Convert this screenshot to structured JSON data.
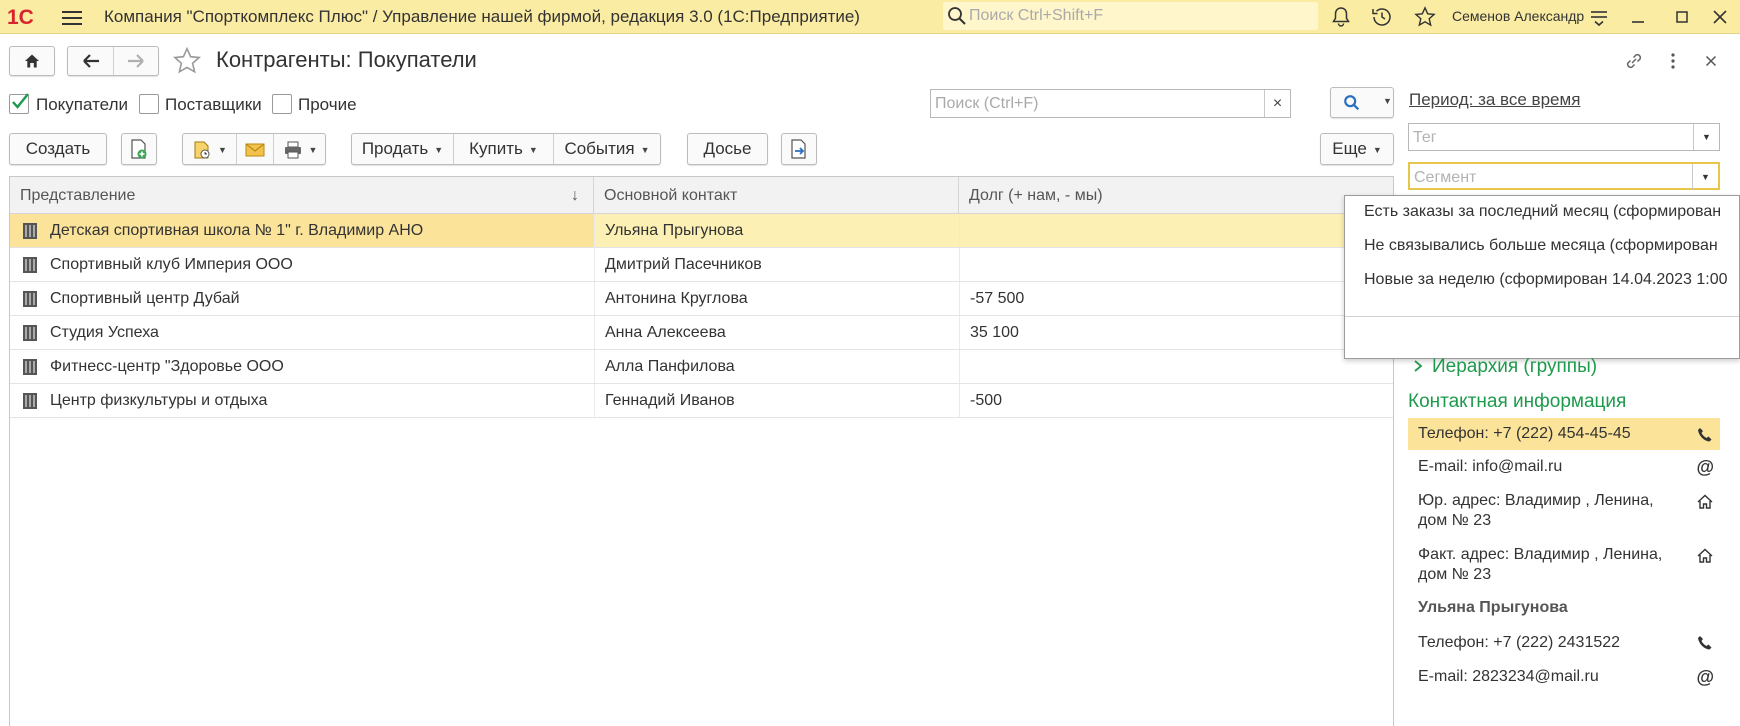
{
  "app": {
    "logo_text": "1С",
    "title": "Компания \"Спорткомплекс Плюс\" / Управление нашей фирмой, редакция 3.0  (1С:Предприятие)",
    "search_placeholder": "Поиск Ctrl+Shift+F",
    "user": "Семенов Александр"
  },
  "page": {
    "title": "Контрагенты: Покупатели"
  },
  "filters": [
    {
      "label": "Покупатели",
      "checked": true
    },
    {
      "label": "Поставщики",
      "checked": false
    },
    {
      "label": "Прочие",
      "checked": false
    }
  ],
  "list_search": {
    "placeholder": "Поиск (Ctrl+F)",
    "clear": "×"
  },
  "toolbar": {
    "create": "Создать",
    "sell": "Продать",
    "buy": "Купить",
    "events": "События",
    "dossier": "Досье",
    "more": "Еще"
  },
  "table": {
    "columns": [
      "Представление",
      "Основной контакт",
      "Долг (+ нам, - мы)"
    ],
    "sort_indicator": "↓",
    "rows": [
      {
        "name": "Детская спортивная школа  № 1\" г. Владимир АНО",
        "contact": "Ульяна Прыгунова",
        "debt": "",
        "selected": true
      },
      {
        "name": "Спортивный клуб Империя ООО",
        "contact": "Дмитрий Пасечников",
        "debt": ""
      },
      {
        "name": "Спортивный центр Дубай",
        "contact": "Антонина Круглова",
        "debt": "-57 500"
      },
      {
        "name": "Студия Успеха",
        "contact": "Анна Алексеева",
        "debt": "35 100"
      },
      {
        "name": "Фитнесс-центр \"Здоровье ООО",
        "contact": "Алла Панфилова",
        "debt": ""
      },
      {
        "name": "Центр физкультуры и отдыха",
        "contact": "Геннадий Иванов",
        "debt": "-500"
      }
    ]
  },
  "side": {
    "period": "Период: за все время",
    "tag_placeholder": "Тег",
    "segment_placeholder": "Сегмент",
    "segment_options": [
      "Есть заказы за последний месяц (сформирован",
      "Не связывались больше месяца (сформирован",
      "Новые за неделю (сформирован 14.04.2023 1:00"
    ],
    "hierarchy": "Иерархия (группы)",
    "contact_info_title": "Контактная информация",
    "company_contacts": [
      {
        "text": "Телефон: +7 (222) 454-45-45",
        "icon": "phone-icon",
        "selected": true
      },
      {
        "text": "E-mail: info@mail.ru",
        "icon": "email-icon"
      },
      {
        "text": "Юр. адрес: Владимир , Ленина, дом № 23",
        "icon": "home-icon"
      },
      {
        "text": "Факт. адрес: Владимир , Ленина, дом № 23",
        "icon": "home-icon"
      }
    ],
    "person": "Ульяна Прыгунова",
    "person_contacts": [
      {
        "text": "Телефон: +7 (222) 2431522",
        "icon": "phone-icon"
      },
      {
        "text": "E-mail: 2823234@mail.ru",
        "icon": "email-icon"
      }
    ]
  },
  "colors": {
    "topbar": "#fbeca4",
    "selection": "#fdf0b4",
    "accent_green": "#1e9a4c",
    "logo_red": "#d8252d"
  }
}
